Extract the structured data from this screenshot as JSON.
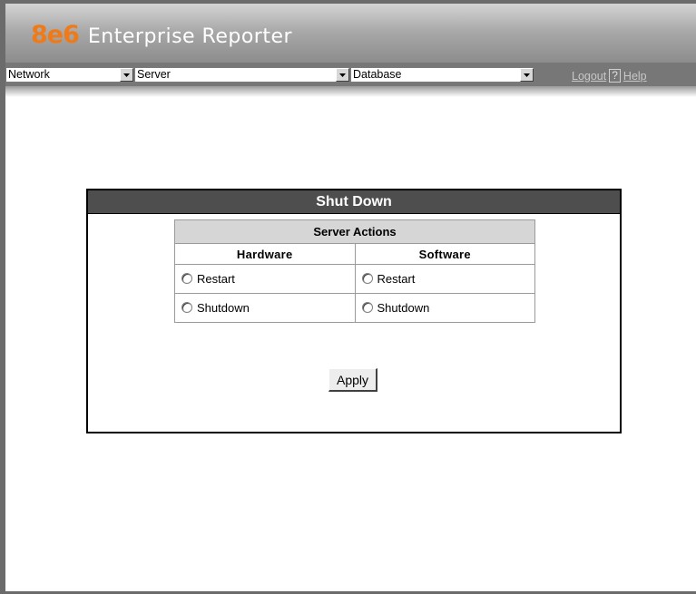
{
  "brand": {
    "logo_mark": "8e6",
    "product_name": "Enterprise Reporter",
    "accent_color": "#f07a17"
  },
  "nav": {
    "dropdowns": [
      {
        "selected": "Network"
      },
      {
        "selected": "Server"
      },
      {
        "selected": "Database"
      }
    ],
    "logout_label": "Logout",
    "help_icon_glyph": "?",
    "help_label": "Help"
  },
  "panel": {
    "title": "Shut Down",
    "table_caption": "Server Actions",
    "columns": [
      "Hardware",
      "Software"
    ],
    "rows": [
      {
        "hardware": "Restart",
        "software": "Restart"
      },
      {
        "hardware": "Shutdown",
        "software": "Shutdown"
      }
    ],
    "apply_label": "Apply"
  }
}
